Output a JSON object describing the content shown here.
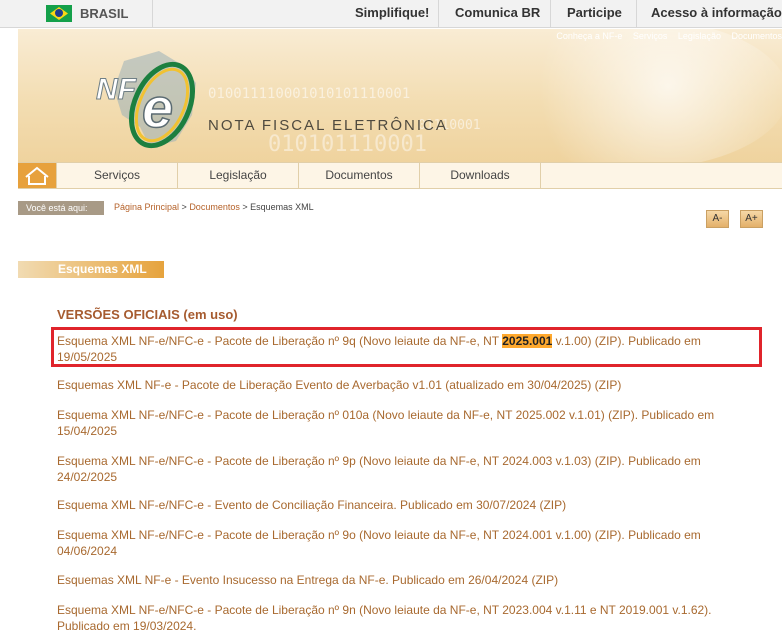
{
  "gov_bar": {
    "country": "BRASIL",
    "links": [
      "Simplifique!",
      "Comunica BR",
      "Participe",
      "Acesso à informação"
    ]
  },
  "banner": {
    "top_links": [
      "Conheça a NF-e",
      "Serviços",
      "Legislação",
      "Documentos"
    ],
    "logo_text": "NF-e",
    "title": "NOTA FISCAL ELETRÔNICA",
    "binary_lines": [
      "010011110001010101110001",
      "01110001",
      "010101110001"
    ]
  },
  "nav": {
    "tabs": [
      "Serviços",
      "Legislação",
      "Documentos",
      "Downloads"
    ]
  },
  "breadcrumb": {
    "label": "Você está aqui:",
    "items": [
      "Página Principal",
      "Documentos",
      "Esquemas XML"
    ],
    "separator": " > "
  },
  "font_buttons": [
    "A-",
    "A+"
  ],
  "page": {
    "section_title": "Esquemas XML",
    "versions_title": "VERSÕES OFICIAIS (em uso)"
  },
  "items": [
    {
      "before": "Esquema XML NF-e/NFC-e - Pacote de Liberação nº 9q (Novo leiaute da NF-e, NT ",
      "highlight": "2025.001",
      "after": " v.1.00) (ZIP). Publicado em 19/05/2025"
    },
    {
      "text": "Esquemas XML NF-e - Pacote de Liberação Evento de Averbação v1.01 (atualizado em 30/04/2025) (ZIP)"
    },
    {
      "text": "Esquema XML NF-e/NFC-e - Pacote de Liberação nº 010a (Novo leiaute da NF-e, NT 2025.002 v.1.01) (ZIP). Publicado em 15/04/2025"
    },
    {
      "text": "Esquema XML NF-e/NFC-e - Pacote de Liberação nº 9p (Novo leiaute da NF-e, NT 2024.003 v.1.03) (ZIP). Publicado em 24/02/2025"
    },
    {
      "text": "Esquema XML NF-e/NFC-e - Evento de Conciliação Financeira. Publicado em 30/07/2024 (ZIP)"
    },
    {
      "text": "Esquema XML NF-e/NFC-e - Pacote de Liberação nº 9o (Novo leiaute da NF-e, NT 2024.001 v.1.00) (ZIP). Publicado em 04/06/2024"
    },
    {
      "text": "Esquemas XML NF-e - Evento Insucesso na Entrega da NF-e. Publicado em 26/04/2024 (ZIP)"
    },
    {
      "text": "Esquema XML NF-e/NFC-e - Pacote de Liberação nº 9n (Novo leiaute da NF-e, NT 2023.004 v.1.11 e NT 2019.001 v.1.62). Publicado em 19/03/2024."
    }
  ],
  "colors": {
    "accent": "#e6a33d",
    "link": "#a8692f",
    "highlight_box": "#e0242b"
  }
}
